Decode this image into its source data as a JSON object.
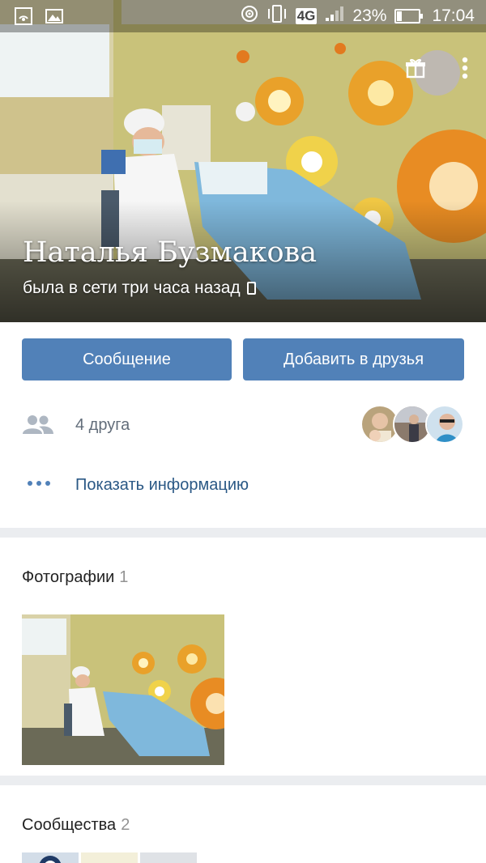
{
  "status_bar": {
    "network": "4G",
    "battery": "23%",
    "battery_level": 0.23,
    "time": "17:04"
  },
  "profile": {
    "name": "Наталья Бузмакова",
    "status": "была в сети три часа назад"
  },
  "actions": {
    "message": "Сообщение",
    "add_friend": "Добавить в друзья"
  },
  "friends": {
    "count_label": "4 друга"
  },
  "info": {
    "show_info": "Показать информацию"
  },
  "photos": {
    "title": "Фотографии",
    "count": "1"
  },
  "communities": {
    "title": "Сообщества",
    "count": "2"
  },
  "colors": {
    "accent": "#5181b8",
    "link": "#2a5885",
    "muted": "#626d7a",
    "background": "#ebedf0"
  },
  "icons": [
    "hotspot-icon",
    "gallery-icon",
    "vibrate-icon",
    "signal-icon",
    "battery-icon",
    "back-icon",
    "gift-icon",
    "more-vertical-icon",
    "phone-icon",
    "friends-icon",
    "dots-icon"
  ]
}
